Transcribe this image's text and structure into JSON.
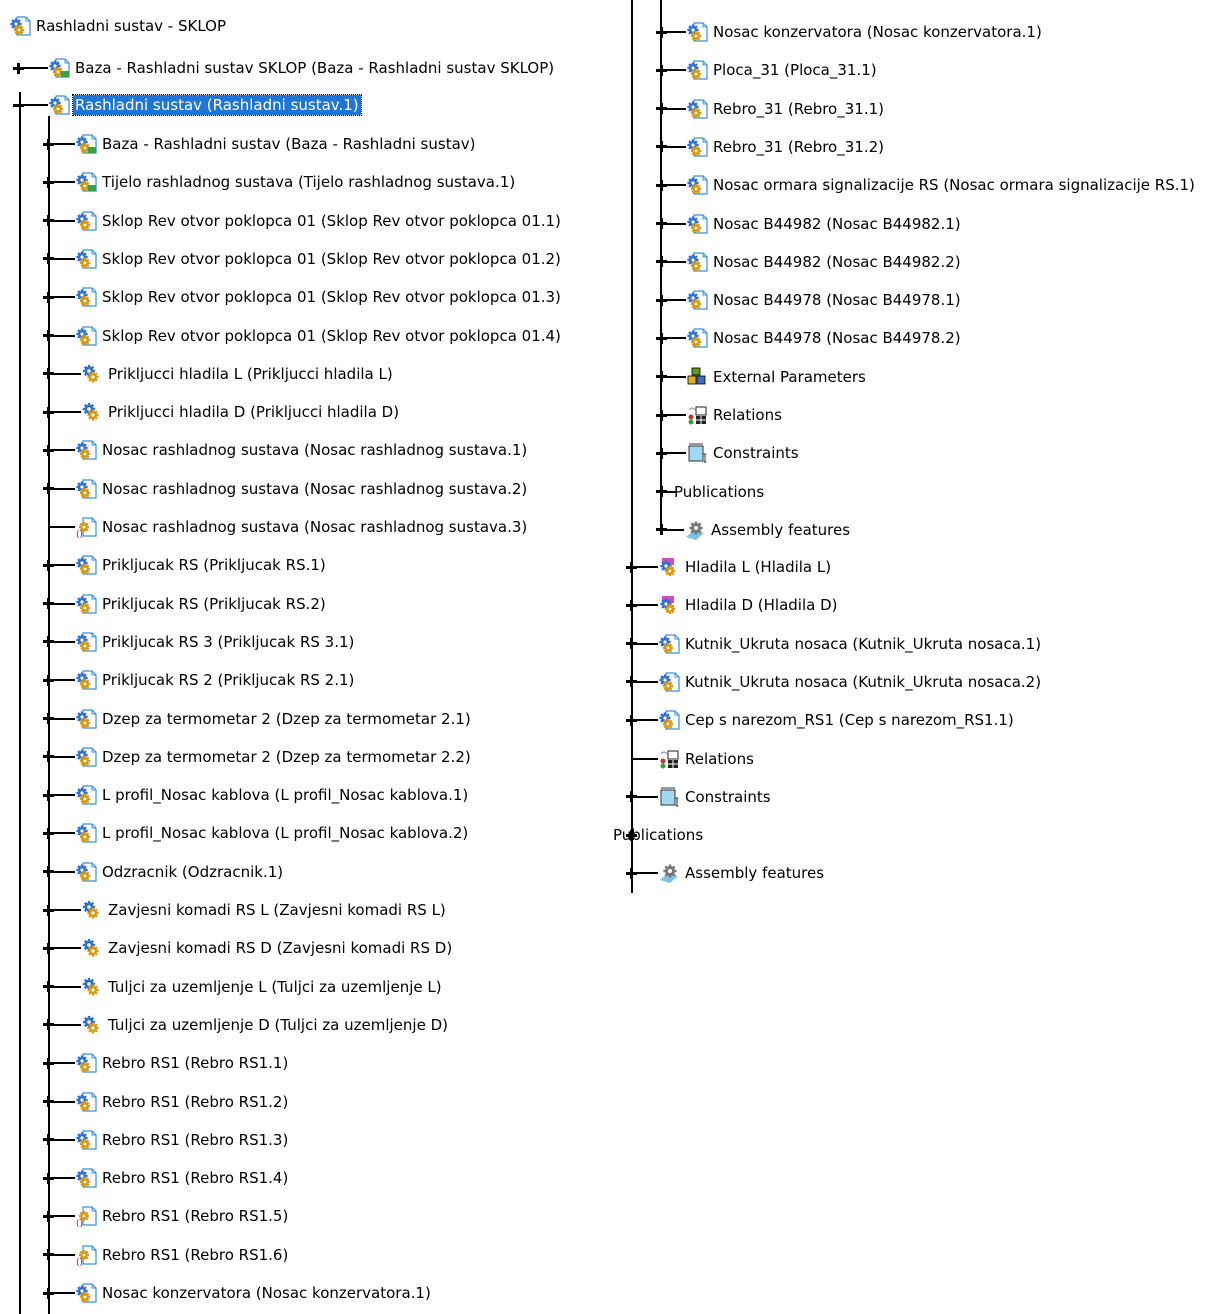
{
  "tree": {
    "root": {
      "label": "Rashladni sustav - SKLOP",
      "icon": "product-icon"
    },
    "baza": {
      "label": "Baza - Rashladni sustav SKLOP (Baza - Rashladni sustav SKLOP)",
      "icon": "component-gear-icon"
    },
    "selected": {
      "label": "Rashladni sustav (Rashladni sustav.1)",
      "icon": "product-icon"
    },
    "left_children": [
      {
        "label": "Baza - Rashladni sustav (Baza - Rashladni sustav)",
        "icon": "component-gear-icon"
      },
      {
        "label": "Tijelo rashladnog sustava (Tijelo rashladnog sustava.1)",
        "icon": "component-gear-icon"
      },
      {
        "label": "Sklop Rev otvor poklopca 01 (Sklop Rev otvor poklopca 01.1)",
        "icon": "product-icon"
      },
      {
        "label": "Sklop Rev otvor poklopca 01 (Sklop Rev otvor poklopca 01.2)",
        "icon": "product-icon"
      },
      {
        "label": "Sklop Rev otvor poklopca 01 (Sklop Rev otvor poklopca 01.3)",
        "icon": "product-icon"
      },
      {
        "label": "Sklop Rev otvor poklopca 01 (Sklop Rev otvor poklopca 01.4)",
        "icon": "product-icon"
      },
      {
        "label": "Prikljucci hladila L (Prikljucci hladila L)",
        "icon": "component-icon"
      },
      {
        "label": "Prikljucci hladila D (Prikljucci hladila D)",
        "icon": "component-icon"
      },
      {
        "label": "Nosac rashladnog sustava (Nosac rashladnog sustava.1)",
        "icon": "product-icon"
      },
      {
        "label": "Nosac rashladnog sustava (Nosac rashladnog sustava.2)",
        "icon": "product-icon"
      },
      {
        "label": "Nosac rashladnog sustava (Nosac rashladnog sustava.3)",
        "icon": "product-unloaded-icon"
      },
      {
        "label": "Prikljucak RS (Prikljucak RS.1)",
        "icon": "product-icon"
      },
      {
        "label": "Prikljucak RS (Prikljucak RS.2)",
        "icon": "product-icon"
      },
      {
        "label": "Prikljucak RS 3 (Prikljucak RS 3.1)",
        "icon": "product-icon"
      },
      {
        "label": "Prikljucak RS 2 (Prikljucak RS 2.1)",
        "icon": "product-icon"
      },
      {
        "label": "Dzep za termometar 2 (Dzep za termometar 2.1)",
        "icon": "product-icon"
      },
      {
        "label": "Dzep za termometar 2 (Dzep za termometar 2.2)",
        "icon": "product-icon"
      },
      {
        "label": "L profil_Nosac kablova (L profil_Nosac kablova.1)",
        "icon": "product-icon"
      },
      {
        "label": "L profil_Nosac kablova (L profil_Nosac kablova.2)",
        "icon": "product-icon"
      },
      {
        "label": "Odzracnik (Odzracnik.1)",
        "icon": "product-icon"
      },
      {
        "label": "Zavjesni komadi RS L (Zavjesni komadi RS L)",
        "icon": "component-icon"
      },
      {
        "label": "Zavjesni komadi RS D (Zavjesni komadi RS D)",
        "icon": "component-icon"
      },
      {
        "label": "Tuljci za uzemljenje L (Tuljci za uzemljenje L)",
        "icon": "component-icon"
      },
      {
        "label": "Tuljci za uzemljenje D (Tuljci za uzemljenje D)",
        "icon": "component-icon"
      },
      {
        "label": "Rebro RS1 (Rebro RS1.1)",
        "icon": "product-icon"
      },
      {
        "label": "Rebro RS1 (Rebro RS1.2)",
        "icon": "product-icon"
      },
      {
        "label": "Rebro RS1 (Rebro RS1.3)",
        "icon": "product-icon"
      },
      {
        "label": "Rebro RS1 (Rebro RS1.4)",
        "icon": "product-icon"
      },
      {
        "label": "Rebro RS1 (Rebro RS1.5)",
        "icon": "product-unloaded-icon"
      },
      {
        "label": "Rebro RS1 (Rebro RS1.6)",
        "icon": "product-unloaded-icon"
      },
      {
        "label": "Nosac konzervatora (Nosac konzervatora.1)",
        "icon": "product-icon"
      }
    ],
    "right_children": [
      {
        "label": "Nosac konzervatora (Nosac konzervatora.1)",
        "icon": "product-icon"
      },
      {
        "label": "Ploca_31 (Ploca_31.1)",
        "icon": "product-icon"
      },
      {
        "label": "Rebro_31 (Rebro_31.1)",
        "icon": "product-icon"
      },
      {
        "label": "Rebro_31 (Rebro_31.2)",
        "icon": "product-icon"
      },
      {
        "label": "Nosac ormara signalizacije RS (Nosac ormara signalizacije RS.1)",
        "icon": "product-icon"
      },
      {
        "label": "Nosac B44982 (Nosac B44982.1)",
        "icon": "product-icon"
      },
      {
        "label": "Nosac B44982 (Nosac B44982.2)",
        "icon": "product-icon"
      },
      {
        "label": "Nosac B44978 (Nosac B44978.1)",
        "icon": "product-icon"
      },
      {
        "label": "Nosac B44978 (Nosac B44978.2)",
        "icon": "product-icon"
      },
      {
        "label": "External Parameters",
        "icon": "external-parameters-icon"
      },
      {
        "label": "Relations",
        "icon": "relations-icon"
      },
      {
        "label": "Constraints",
        "icon": "constraints-icon"
      },
      {
        "label": "Publications",
        "icon": "none"
      },
      {
        "label": "Assembly features",
        "icon": "assembly-features-icon"
      }
    ],
    "root_children_rest": [
      {
        "label": "Hladila L (Hladila L)",
        "icon": "component-pink-icon"
      },
      {
        "label": "Hladila D (Hladila D)",
        "icon": "component-pink-icon"
      },
      {
        "label": "Kutnik_Ukruta nosaca (Kutnik_Ukruta nosaca.1)",
        "icon": "product-icon"
      },
      {
        "label": "Kutnik_Ukruta nosaca (Kutnik_Ukruta nosaca.2)",
        "icon": "product-icon"
      },
      {
        "label": "Cep s narezom_RS1 (Cep s narezom_RS1.1)",
        "icon": "product-icon"
      },
      {
        "label": "Relations",
        "icon": "relations-icon"
      },
      {
        "label": "Constraints",
        "icon": "constraints-icon"
      },
      {
        "label": "Publications",
        "icon": "none"
      },
      {
        "label": "Assembly features",
        "icon": "assembly-features-icon"
      }
    ]
  },
  "colors": {
    "selection": "#1e75d6",
    "gear_blue": "#2f6fd0",
    "gear_orange": "#d89a10",
    "doc_outline": "#3a8fd8",
    "pink": "#d04fc0"
  }
}
